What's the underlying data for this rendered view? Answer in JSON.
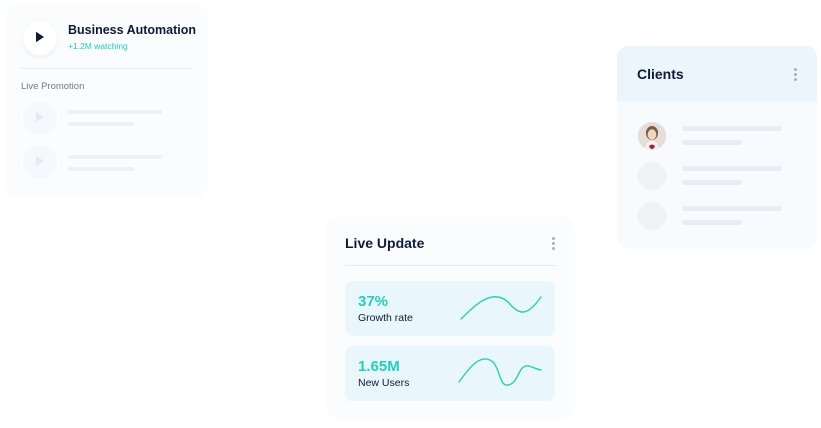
{
  "video_card": {
    "title": "Business Automation",
    "subtitle": "+1.2M watching",
    "section_label": "Live Promotion"
  },
  "clients_card": {
    "title": "Clients"
  },
  "live_update_card": {
    "title": "Live Update",
    "stats": [
      {
        "value": "37%",
        "label": "Growth rate"
      },
      {
        "value": "1.65M",
        "label": "New Users"
      }
    ]
  },
  "colors": {
    "accent": "#1fd3b9",
    "heading": "#0f1a3a",
    "clients_header_bg": "#eaf5fc",
    "stat_bg": "#e9f6fc"
  },
  "icons": [
    "play-icon",
    "more-vertical-icon",
    "sparkline"
  ]
}
